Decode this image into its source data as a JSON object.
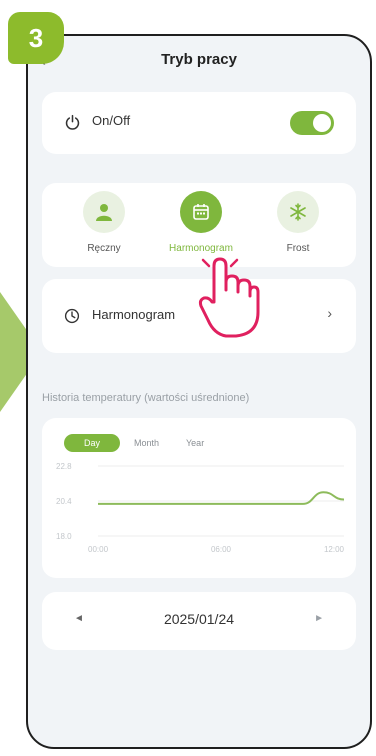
{
  "step": {
    "number": "3"
  },
  "header": {
    "title": "Tryb pracy"
  },
  "power": {
    "label": "On/Off",
    "is_on": true
  },
  "modes": [
    {
      "label": "Ręczny",
      "icon": "person-icon",
      "active": false
    },
    {
      "label": "Harmonogram",
      "icon": "calendar-icon",
      "active": true
    },
    {
      "label": "Frost",
      "icon": "snowflake-icon",
      "active": false
    }
  ],
  "schedule": {
    "label": "Harmonogram",
    "chevron": "›"
  },
  "history": {
    "title": "Historia temperatury (wartości uśrednione)",
    "tabs": {
      "day": "Day",
      "month": "Month",
      "year": "Year"
    },
    "selected_tab": "Day"
  },
  "chart_data": {
    "type": "line",
    "y_ticks": [
      "22.8",
      "20.4",
      "18.0"
    ],
    "x_ticks": [
      "00:00",
      "06:00",
      "12:00"
    ],
    "ylim": [
      18.0,
      22.8
    ],
    "x": [
      "00:00",
      "02:00",
      "04:00",
      "06:00",
      "08:00",
      "09:00",
      "10:00",
      "11:00",
      "12:00"
    ],
    "values": [
      20.2,
      20.2,
      20.2,
      20.2,
      20.2,
      20.2,
      20.2,
      21.0,
      20.5
    ],
    "color": "#8dbb5b",
    "grid": true
  },
  "date_nav": {
    "date": "2025/01/24",
    "prev": "◄",
    "next": "►"
  },
  "colors": {
    "accent": "#7fb73d",
    "badge": "#8dbb2c",
    "pointer": "#e0205f"
  }
}
